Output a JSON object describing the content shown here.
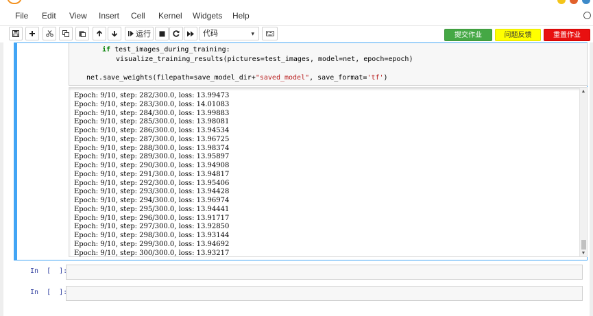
{
  "menu": {
    "items": [
      "File",
      "Edit",
      "View",
      "Insert",
      "Cell",
      "Kernel",
      "Widgets",
      "Help"
    ]
  },
  "toolbar": {
    "run_label": "运行",
    "cell_type": "代码",
    "submit_label": "提交作业",
    "feedback_label": "问题反馈",
    "redo_label": "重置作业",
    "colors": {
      "submit": "#45a845",
      "feedback": "#ffff00",
      "redo": "#e81010"
    },
    "icons": [
      "save-icon",
      "plus-icon",
      "cut-icon",
      "copy-icon",
      "paste-icon",
      "arrow-up-icon",
      "arrow-down-icon",
      "run-icon",
      "stop-icon",
      "restart-icon",
      "fast-forward-icon",
      "keyboard-icon"
    ]
  },
  "code": {
    "lines": [
      {
        "indent": "        ",
        "kw": "if",
        "rest": " test_images_during_training:"
      },
      {
        "indent": "            ",
        "kw": "",
        "rest": "visualize_training_results(pictures=test_images, model=net, epoch=epoch)"
      },
      {
        "indent": "",
        "kw": "",
        "rest": ""
      },
      {
        "indent": "    ",
        "kw": "",
        "rest": "net.save_weights(filepath=save_model_dir+",
        "str": "\"saved_model\"",
        "rest2": ", save_format=",
        "str2": "'tf'",
        "rest3": ")"
      }
    ]
  },
  "output": {
    "lines": [
      "Epoch: 9/10, step: 282/300.0, loss: 13.99473",
      "Epoch: 9/10, step: 283/300.0, loss: 14.01083",
      "Epoch: 9/10, step: 284/300.0, loss: 13.99883",
      "Epoch: 9/10, step: 285/300.0, loss: 13.98081",
      "Epoch: 9/10, step: 286/300.0, loss: 13.94534",
      "Epoch: 9/10, step: 287/300.0, loss: 13.96725",
      "Epoch: 9/10, step: 288/300.0, loss: 13.98374",
      "Epoch: 9/10, step: 289/300.0, loss: 13.95897",
      "Epoch: 9/10, step: 290/300.0, loss: 13.94908",
      "Epoch: 9/10, step: 291/300.0, loss: 13.94817",
      "Epoch: 9/10, step: 292/300.0, loss: 13.95406",
      "Epoch: 9/10, step: 293/300.0, loss: 13.94428",
      "Epoch: 9/10, step: 294/300.0, loss: 13.96974",
      "Epoch: 9/10, step: 295/300.0, loss: 13.94441",
      "Epoch: 9/10, step: 296/300.0, loss: 13.91717",
      "Epoch: 9/10, step: 297/300.0, loss: 13.92850",
      "Epoch: 9/10, step: 298/300.0, loss: 13.93144",
      "Epoch: 9/10, step: 299/300.0, loss: 13.94692",
      "Epoch: 9/10, step: 300/300.0, loss: 13.93217"
    ]
  },
  "empty_cells": [
    {
      "prompt": "In  [  ]:"
    },
    {
      "prompt": "In  [  ]:"
    }
  ]
}
